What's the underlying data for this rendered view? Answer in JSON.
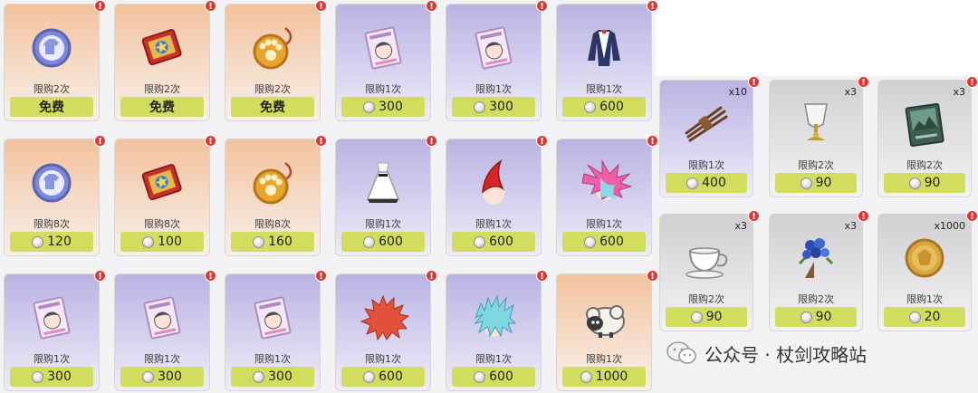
{
  "left_shop": [
    {
      "bg": "orange",
      "icon": "outfit-token-icon",
      "limit": "限购2次",
      "price": "免费",
      "free": true
    },
    {
      "bg": "orange",
      "icon": "red-ticket-icon",
      "limit": "限购2次",
      "price": "免费",
      "free": true
    },
    {
      "bg": "orange",
      "icon": "paw-charm-icon",
      "limit": "限购2次",
      "price": "免费",
      "free": true
    },
    {
      "bg": "purple",
      "icon": "photo-card-pack-icon",
      "limit": "限购1次",
      "price": "300",
      "free": false
    },
    {
      "bg": "purple",
      "icon": "photo-card-pack-icon",
      "limit": "限购1次",
      "price": "300",
      "free": false
    },
    {
      "bg": "purple",
      "icon": "coat-outfit-icon",
      "limit": "限购1次",
      "price": "600",
      "free": false
    },
    {
      "bg": "orange",
      "icon": "outfit-token-icon",
      "limit": "限购8次",
      "price": "120",
      "free": false
    },
    {
      "bg": "orange",
      "icon": "red-ticket-icon",
      "limit": "限购8次",
      "price": "100",
      "free": false
    },
    {
      "bg": "orange",
      "icon": "paw-charm-icon",
      "limit": "限购8次",
      "price": "160",
      "free": false
    },
    {
      "bg": "purple",
      "icon": "white-dress-icon",
      "limit": "限购1次",
      "price": "600",
      "free": false
    },
    {
      "bg": "purple",
      "icon": "red-hair-spike-icon",
      "limit": "限购1次",
      "price": "600",
      "free": false
    },
    {
      "bg": "purple",
      "icon": "pink-spiky-hair-icon",
      "limit": "限购1次",
      "price": "600",
      "free": false
    },
    {
      "bg": "purple",
      "icon": "photo-card-pack-icon",
      "limit": "限购1次",
      "price": "300",
      "free": false
    },
    {
      "bg": "purple",
      "icon": "photo-card-pack-icon",
      "limit": "限购1次",
      "price": "300",
      "free": false
    },
    {
      "bg": "purple",
      "icon": "photo-card-pack-icon",
      "limit": "限购1次",
      "price": "300",
      "free": false
    },
    {
      "bg": "purple",
      "icon": "red-spiky-hair-icon",
      "limit": "限购1次",
      "price": "600",
      "free": false
    },
    {
      "bg": "purple",
      "icon": "cyan-spiky-hair-icon",
      "limit": "限购1次",
      "price": "600",
      "free": false
    },
    {
      "bg": "orange",
      "icon": "sheep-pet-icon",
      "limit": "限购1次",
      "price": "1000",
      "free": false
    }
  ],
  "right_shop": [
    {
      "bg": "purple",
      "icon": "rope-bundle-icon",
      "qty": "x10",
      "limit": "限购1次",
      "price": "400"
    },
    {
      "bg": "gray",
      "icon": "goblet-icon",
      "qty": "x3",
      "limit": "限购2次",
      "price": "90"
    },
    {
      "bg": "gray",
      "icon": "book-icon",
      "qty": "x3",
      "limit": "限购2次",
      "price": "90"
    },
    {
      "bg": "gray",
      "icon": "teacup-icon",
      "qty": "x3",
      "limit": "限购2次",
      "price": "90"
    },
    {
      "bg": "gray",
      "icon": "flower-bouquet-icon",
      "qty": "x3",
      "limit": "限购2次",
      "price": "90"
    },
    {
      "bg": "gray",
      "icon": "gold-coin-icon",
      "qty": "x1000",
      "limit": "限购1次",
      "price": "20"
    }
  ],
  "badge_glyph": "!",
  "watermark": {
    "text": "公众号 · 杖剑攻略站",
    "icon": "wechat-logo-icon"
  },
  "colors": {
    "price_bar": "#d1dd5d",
    "badge": "#e3342f",
    "card_orange": "#f3c19c",
    "card_purple": "#b9b3e2",
    "card_gray": "#d0d0d2"
  }
}
